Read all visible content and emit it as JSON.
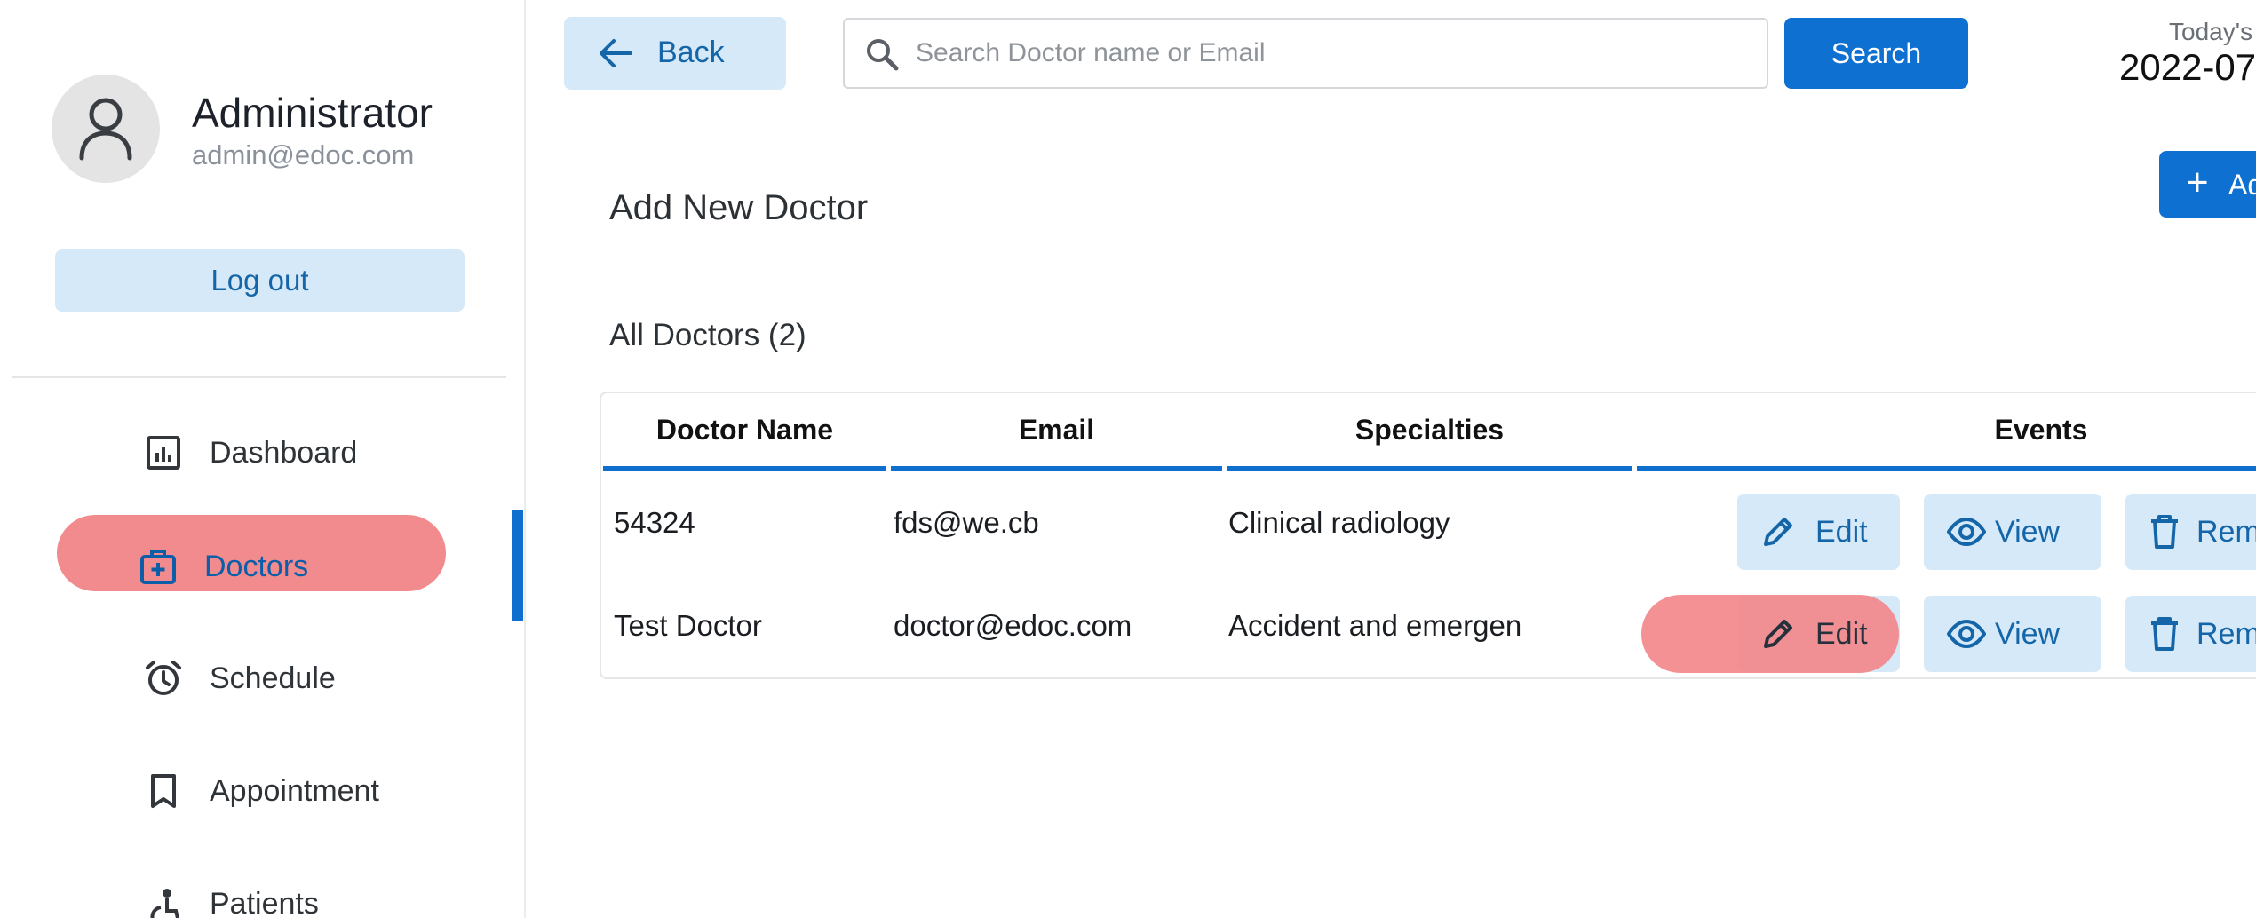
{
  "profile": {
    "name": "Administrator",
    "email": "admin@edoc.com",
    "avatar_icon": "user-icon"
  },
  "sidebar": {
    "logout_label": "Log out",
    "items": [
      {
        "label": "Dashboard",
        "icon": "dashboard-icon"
      },
      {
        "label": "Doctors",
        "icon": "medical-bag-icon",
        "active": true
      },
      {
        "label": "Schedule",
        "icon": "alarm-clock-icon"
      },
      {
        "label": "Appointment",
        "icon": "bookmark-icon"
      },
      {
        "label": "Patients",
        "icon": "accessible-icon"
      }
    ]
  },
  "header": {
    "back_label": "Back",
    "search_placeholder": "Search Doctor name or Email",
    "search_value": "",
    "search_button_label": "Search",
    "date_label": "Today's Date",
    "date_value": "2022-07"
  },
  "main": {
    "add_new_title": "Add New Doctor",
    "add_new_button_label": "Add New",
    "section_title": "All Doctors (2)",
    "table": {
      "columns": [
        "Doctor Name",
        "Email",
        "Specialties",
        "Events"
      ],
      "rows": [
        {
          "name": "54324",
          "email": "fds@we.cb",
          "specialty": "Clinical radiology"
        },
        {
          "name": "Test Doctor",
          "email": "doctor@edoc.com",
          "specialty": "Accident and emergen"
        }
      ],
      "actions": {
        "edit": "Edit",
        "view": "View",
        "remove": "Remove"
      }
    }
  },
  "colors": {
    "accent": "#0e70d1",
    "accent_light": "#d6e9f8",
    "highlight": "#f28b8e"
  }
}
